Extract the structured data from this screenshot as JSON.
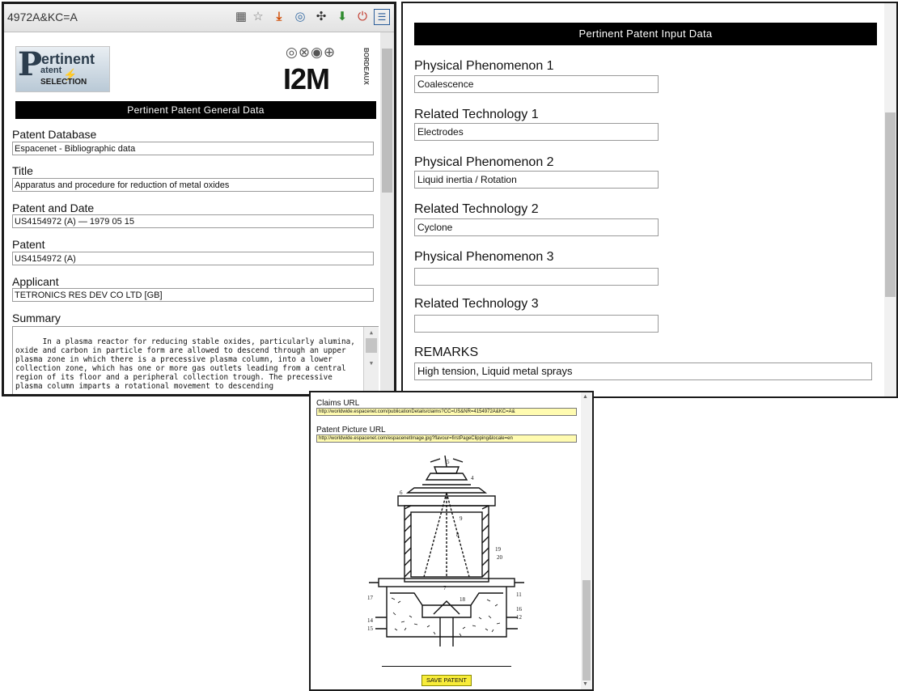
{
  "left_panel": {
    "url": "4972A&KC=A",
    "logo": {
      "letter": "P",
      "word": "ertinent",
      "small": "atent",
      "selection": "SELECTION",
      "org": "I2M",
      "org_sub": "BORDEAUX"
    },
    "banner": "Pertinent Patent General Data",
    "fields": {
      "database": {
        "label": "Patent Database",
        "value": "Espacenet - Bibliographic data"
      },
      "title": {
        "label": "Title",
        "value": "Apparatus and procedure for reduction of metal oxides"
      },
      "patent_date": {
        "label": "Patent and Date",
        "value": "US4154972 (A) — 1979 05 15"
      },
      "patent": {
        "label": "Patent",
        "value": "US4154972 (A)"
      },
      "applicant": {
        "label": "Applicant",
        "value": "TETRONICS RES   DEV CO LTD  [GB]"
      },
      "summary": {
        "label": "Summary",
        "value": "In a plasma reactor for reducing stable oxides, particularly alumina, oxide and carbon in particle form are allowed to descend through an upper plasma zone in which there is a precessive plasma column, into a lower collection zone, which has one or more gas outlets leading from a central region of its floor and a peripheral collection trough. The precessive plasma column imparts a rotational movement to descending"
      }
    },
    "icons": [
      "qr-icon",
      "star-icon",
      "download-icon",
      "target-icon",
      "puzzle-icon",
      "arrow-down-icon",
      "power-icon",
      "panel-icon"
    ]
  },
  "right_panel": {
    "banner": "Pertinent Patent Input Data",
    "fields": [
      {
        "label": "Physical Phenomenon 1",
        "value": "Coalescence"
      },
      {
        "label": "Related Technology 1",
        "value": "Electrodes"
      },
      {
        "label": "Physical Phenomenon 2",
        "value": "Liquid inertia / Rotation"
      },
      {
        "label": "Related Technology 2",
        "value": "Cyclone"
      },
      {
        "label": "Physical Phenomenon 3",
        "value": ""
      },
      {
        "label": "Related Technology 3",
        "value": ""
      }
    ],
    "remarks": {
      "label": "REMARKS",
      "value": "High tension, Liquid metal sprays"
    }
  },
  "bottom_panel": {
    "claims_url": {
      "label": "Claims URL",
      "value": "http://worldwide.espacenet.com/publicationDetails/claims?CC=US&NR=4154972A&KC=A&"
    },
    "picture_url": {
      "label": "Patent Picture URL",
      "value": "http://worldwide.espacenet.com/espacenetImage.jpg?flavour=firstPageClipping&locale=en"
    },
    "save_button": "SAVE PATENT"
  },
  "colors": {
    "banner_bg": "#000000",
    "url_field_bg": "#fffbb0",
    "save_button_bg": "#f8ec3a"
  }
}
